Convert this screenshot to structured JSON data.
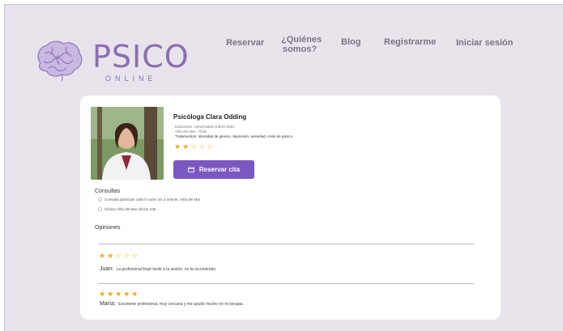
{
  "brand": {
    "name": "PSICO",
    "sub": "ONLINE",
    "color": "#8a6fb3"
  },
  "nav": {
    "reservar": "Reservar",
    "quienes_1": "¿Quiénes",
    "quienes_2": "somos?",
    "blog": "Blog",
    "registrarme": "Registrarme",
    "iniciar": "Iniciar sesión"
  },
  "profile": {
    "name": "Psicóloga Clara Odding",
    "education": "Educación: Universidad Andrés Bello",
    "location": "Viña del Mar - Chile",
    "treatments": "Tratamientos: Identidad de género, depresión, ansiedad, crisis de pánico",
    "rating_stars": "★★☆☆☆",
    "rating": 2,
    "button_label": "Reservar cita",
    "accent": "#7b57c2"
  },
  "consultas": {
    "title": "Consultas",
    "items": [
      "Consulta particular calle 5 norte con 3 oriente, Viña del Mar",
      "Clínica Viña del Mar oficina 235"
    ]
  },
  "opiniones": {
    "title": "Opiniones",
    "reviews": [
      {
        "stars": "★★☆☆☆",
        "rating": 2,
        "author": "Juan:",
        "text": "La profesional llegó tarde a la sesión, no la recomiendo."
      },
      {
        "stars": "★★★★★",
        "rating": 5,
        "author": "María:",
        "text": "Excelente profesional, muy cercana y me ayudó mucho en mi terapia."
      }
    ]
  }
}
